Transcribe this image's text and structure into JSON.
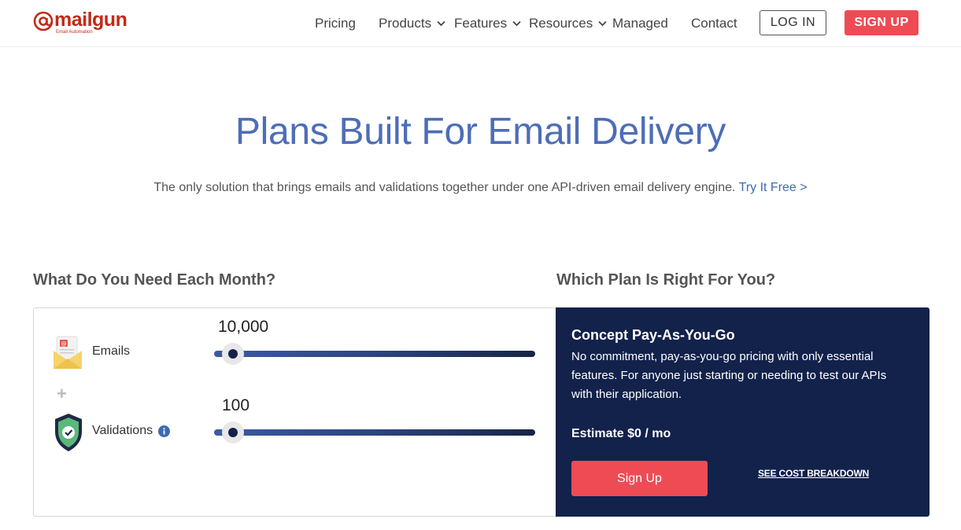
{
  "brand": {
    "logo_text": "mailgun",
    "logo_tagline": "Email Automation",
    "accent": "#c02b18"
  },
  "nav": {
    "pricing": "Pricing",
    "products": "Products",
    "features": "Features",
    "resources": "Resources",
    "managed": "Managed",
    "contact": "Contact",
    "login": "LOG IN",
    "signup": "SIGN UP"
  },
  "hero": {
    "title": "Plans Built For Email Delivery",
    "subtitle": "The only solution that brings emails and validations together under one API-driven email delivery engine.",
    "link": "Try It Free >"
  },
  "calculator": {
    "heading": "What Do You Need Each Month?",
    "emails": {
      "label": "Emails",
      "value": "10,000",
      "slider_fraction": 0.06,
      "icon": "envelope-icon"
    },
    "validations": {
      "label": "Validations",
      "value": "100",
      "slider_fraction": 0.06,
      "icon": "shield-check-icon",
      "info_icon": "info-icon"
    }
  },
  "plan": {
    "heading": "Which Plan Is Right For You?",
    "name": "Concept Pay-As-You-Go",
    "description": "No commitment, pay-as-you-go pricing with only essential features. For anyone just starting or needing to test our APIs with their application.",
    "estimate": "Estimate $0 / mo",
    "cta": "Sign Up",
    "breakdown_link": "SEE COST BREAKDOWN"
  },
  "colors": {
    "primary_blue": "#4d6db7",
    "navy": "#12224b",
    "signup_red": "#ee4b55"
  }
}
